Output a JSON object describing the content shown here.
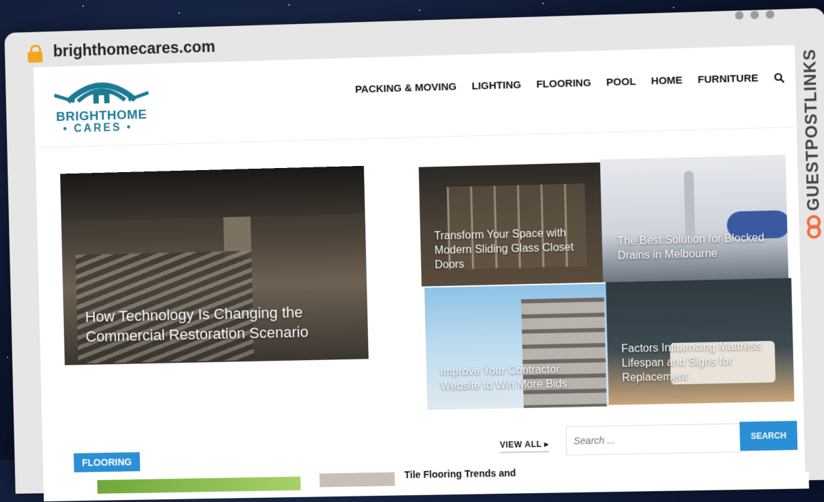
{
  "browser": {
    "url": "brighthomecares.com"
  },
  "site": {
    "logo_line1": "BRIGHTHOME",
    "logo_line2": "• CARES •",
    "nav": [
      "PACKING & MOVING",
      "LIGHTING",
      "FLOORING",
      "POOL",
      "HOME",
      "FURNITURE"
    ]
  },
  "hero": {
    "main_title": "How Technology Is Changing the Commercial Restoration Scenario",
    "tiles": [
      "Transform Your Space with Modern Sliding Glass Closet Doors",
      "The Best Solution for Blocked Drains in Melbourne",
      "Improve Your Contractor Website to Win More Bids",
      "Factors Influencing Mattress Lifespan and Signs for Replacement"
    ]
  },
  "section": {
    "category": "FLOORING",
    "view_all": "VIEW ALL ▸",
    "post_title": "Tile Flooring Trends and"
  },
  "sidebar": {
    "search_placeholder": "Search ...",
    "search_button": "SEARCH"
  },
  "overlay": {
    "brand": "GUESTPOSTLINKS"
  }
}
